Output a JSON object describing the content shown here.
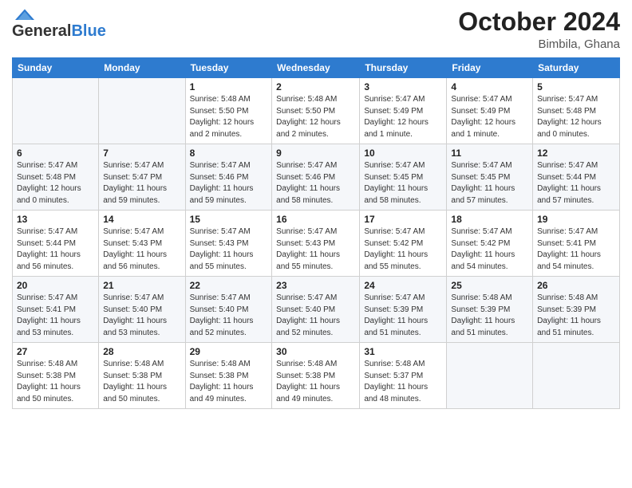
{
  "header": {
    "logo_general": "General",
    "logo_blue": "Blue",
    "month": "October 2024",
    "location": "Bimbila, Ghana"
  },
  "days_of_week": [
    "Sunday",
    "Monday",
    "Tuesday",
    "Wednesday",
    "Thursday",
    "Friday",
    "Saturday"
  ],
  "weeks": [
    [
      {
        "day": "",
        "info": ""
      },
      {
        "day": "",
        "info": ""
      },
      {
        "day": "1",
        "info": "Sunrise: 5:48 AM\nSunset: 5:50 PM\nDaylight: 12 hours and 2 minutes."
      },
      {
        "day": "2",
        "info": "Sunrise: 5:48 AM\nSunset: 5:50 PM\nDaylight: 12 hours and 2 minutes."
      },
      {
        "day": "3",
        "info": "Sunrise: 5:47 AM\nSunset: 5:49 PM\nDaylight: 12 hours and 1 minute."
      },
      {
        "day": "4",
        "info": "Sunrise: 5:47 AM\nSunset: 5:49 PM\nDaylight: 12 hours and 1 minute."
      },
      {
        "day": "5",
        "info": "Sunrise: 5:47 AM\nSunset: 5:48 PM\nDaylight: 12 hours and 0 minutes."
      }
    ],
    [
      {
        "day": "6",
        "info": "Sunrise: 5:47 AM\nSunset: 5:48 PM\nDaylight: 12 hours and 0 minutes."
      },
      {
        "day": "7",
        "info": "Sunrise: 5:47 AM\nSunset: 5:47 PM\nDaylight: 11 hours and 59 minutes."
      },
      {
        "day": "8",
        "info": "Sunrise: 5:47 AM\nSunset: 5:46 PM\nDaylight: 11 hours and 59 minutes."
      },
      {
        "day": "9",
        "info": "Sunrise: 5:47 AM\nSunset: 5:46 PM\nDaylight: 11 hours and 58 minutes."
      },
      {
        "day": "10",
        "info": "Sunrise: 5:47 AM\nSunset: 5:45 PM\nDaylight: 11 hours and 58 minutes."
      },
      {
        "day": "11",
        "info": "Sunrise: 5:47 AM\nSunset: 5:45 PM\nDaylight: 11 hours and 57 minutes."
      },
      {
        "day": "12",
        "info": "Sunrise: 5:47 AM\nSunset: 5:44 PM\nDaylight: 11 hours and 57 minutes."
      }
    ],
    [
      {
        "day": "13",
        "info": "Sunrise: 5:47 AM\nSunset: 5:44 PM\nDaylight: 11 hours and 56 minutes."
      },
      {
        "day": "14",
        "info": "Sunrise: 5:47 AM\nSunset: 5:43 PM\nDaylight: 11 hours and 56 minutes."
      },
      {
        "day": "15",
        "info": "Sunrise: 5:47 AM\nSunset: 5:43 PM\nDaylight: 11 hours and 55 minutes."
      },
      {
        "day": "16",
        "info": "Sunrise: 5:47 AM\nSunset: 5:43 PM\nDaylight: 11 hours and 55 minutes."
      },
      {
        "day": "17",
        "info": "Sunrise: 5:47 AM\nSunset: 5:42 PM\nDaylight: 11 hours and 55 minutes."
      },
      {
        "day": "18",
        "info": "Sunrise: 5:47 AM\nSunset: 5:42 PM\nDaylight: 11 hours and 54 minutes."
      },
      {
        "day": "19",
        "info": "Sunrise: 5:47 AM\nSunset: 5:41 PM\nDaylight: 11 hours and 54 minutes."
      }
    ],
    [
      {
        "day": "20",
        "info": "Sunrise: 5:47 AM\nSunset: 5:41 PM\nDaylight: 11 hours and 53 minutes."
      },
      {
        "day": "21",
        "info": "Sunrise: 5:47 AM\nSunset: 5:40 PM\nDaylight: 11 hours and 53 minutes."
      },
      {
        "day": "22",
        "info": "Sunrise: 5:47 AM\nSunset: 5:40 PM\nDaylight: 11 hours and 52 minutes."
      },
      {
        "day": "23",
        "info": "Sunrise: 5:47 AM\nSunset: 5:40 PM\nDaylight: 11 hours and 52 minutes."
      },
      {
        "day": "24",
        "info": "Sunrise: 5:47 AM\nSunset: 5:39 PM\nDaylight: 11 hours and 51 minutes."
      },
      {
        "day": "25",
        "info": "Sunrise: 5:48 AM\nSunset: 5:39 PM\nDaylight: 11 hours and 51 minutes."
      },
      {
        "day": "26",
        "info": "Sunrise: 5:48 AM\nSunset: 5:39 PM\nDaylight: 11 hours and 51 minutes."
      }
    ],
    [
      {
        "day": "27",
        "info": "Sunrise: 5:48 AM\nSunset: 5:38 PM\nDaylight: 11 hours and 50 minutes."
      },
      {
        "day": "28",
        "info": "Sunrise: 5:48 AM\nSunset: 5:38 PM\nDaylight: 11 hours and 50 minutes."
      },
      {
        "day": "29",
        "info": "Sunrise: 5:48 AM\nSunset: 5:38 PM\nDaylight: 11 hours and 49 minutes."
      },
      {
        "day": "30",
        "info": "Sunrise: 5:48 AM\nSunset: 5:38 PM\nDaylight: 11 hours and 49 minutes."
      },
      {
        "day": "31",
        "info": "Sunrise: 5:48 AM\nSunset: 5:37 PM\nDaylight: 11 hours and 48 minutes."
      },
      {
        "day": "",
        "info": ""
      },
      {
        "day": "",
        "info": ""
      }
    ]
  ]
}
